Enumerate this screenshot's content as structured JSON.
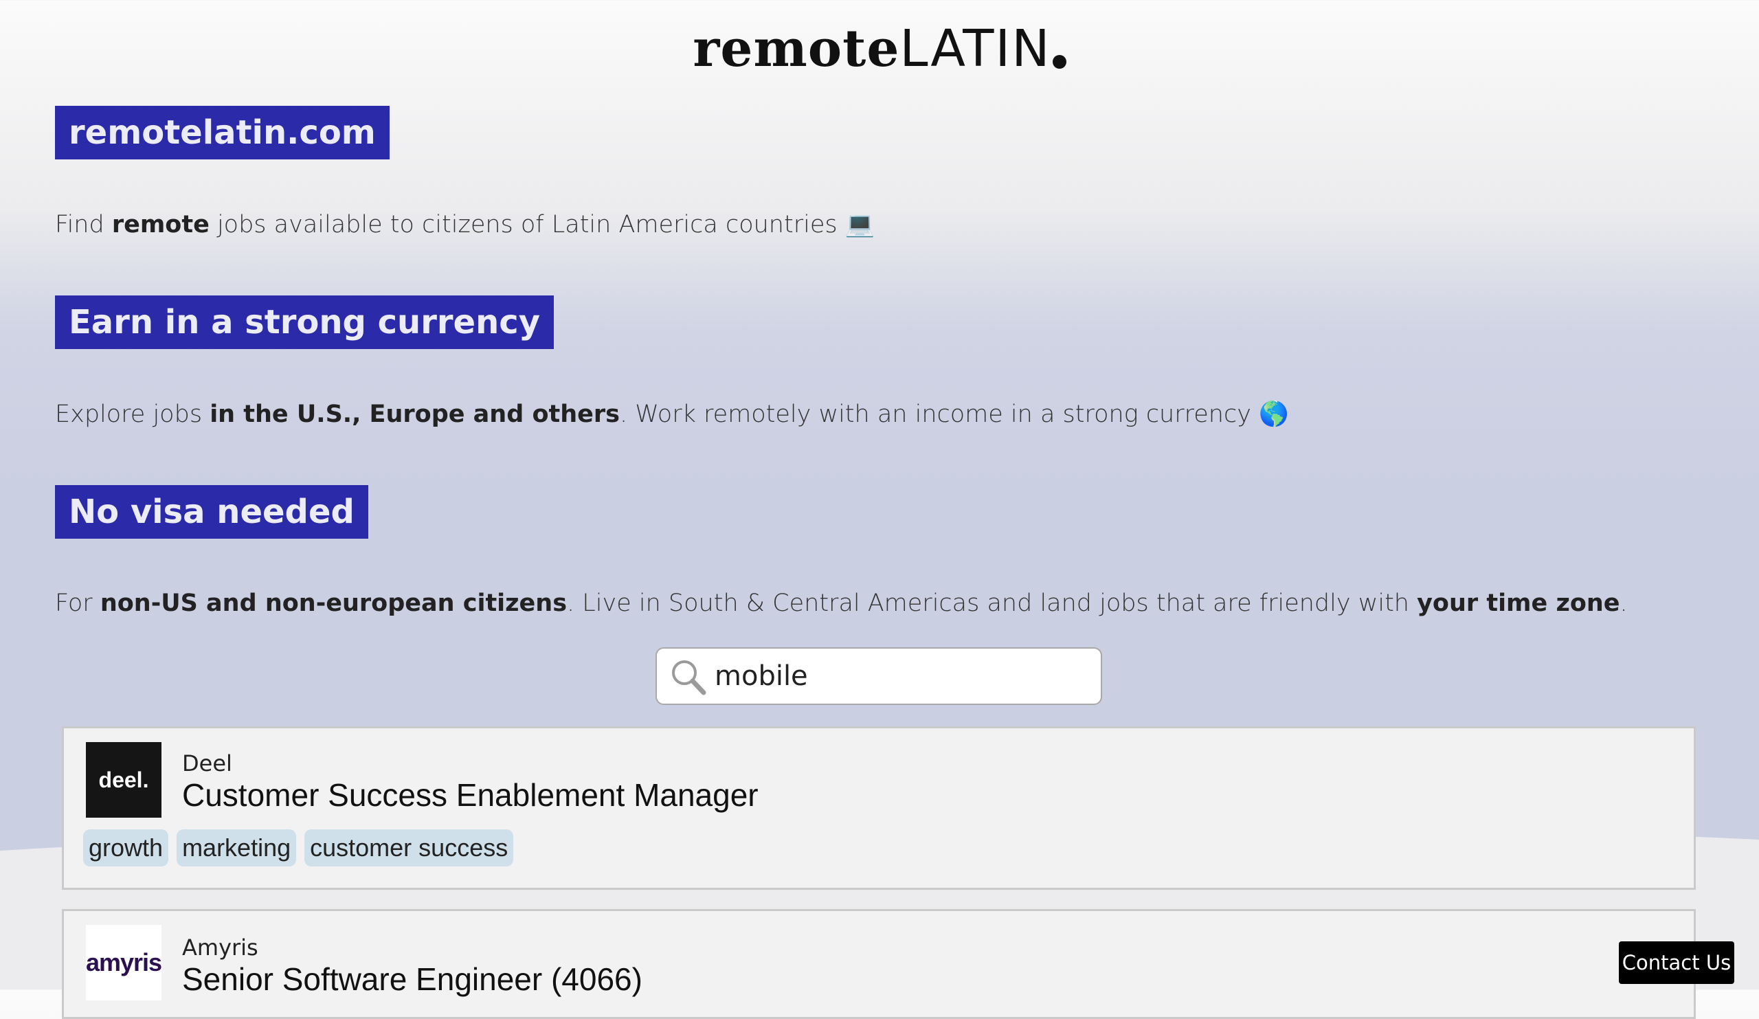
{
  "logo": {
    "primary": "remote",
    "secondary": "LATIN"
  },
  "sections": [
    {
      "heading": "remotelatin.com",
      "para": {
        "p1": "Find ",
        "b1": "remote",
        "p2": " jobs available to citizens of Latin America countries 💻"
      }
    },
    {
      "heading": "Earn in a strong currency",
      "para": {
        "p1": "Explore jobs ",
        "b1": "in the U.S., Europe and others",
        "p2": ". Work remotely with an income in a strong currency 🌎"
      }
    },
    {
      "heading": "No visa needed",
      "para": {
        "p1": "For ",
        "b1": "non-US and non-european citizens",
        "p2": ". Live in South & Central Americas and land jobs that are friendly with ",
        "b2": "your time zone",
        "p3": "."
      }
    }
  ],
  "search": {
    "value": "mobile",
    "icon": "search-icon"
  },
  "jobs": [
    {
      "company": "Deel",
      "logo_text": "deel.",
      "logo_bg": "#151515",
      "logo_fg": "#ffffff",
      "title": "Customer Success Enablement Manager",
      "tags": [
        "growth",
        "marketing",
        "customer success"
      ]
    },
    {
      "company": "Amyris",
      "logo_text": "amyris",
      "logo_bg": "#ffffff",
      "logo_fg": "#2b1150",
      "title": "Senior Software Engineer (4066)",
      "tags": []
    }
  ],
  "contact": {
    "label": "Contact Us"
  },
  "colors": {
    "heading_bg": "#2b2aa8",
    "tag_bg": "#cfe0ea",
    "card_bg": "#f2f2f2"
  }
}
